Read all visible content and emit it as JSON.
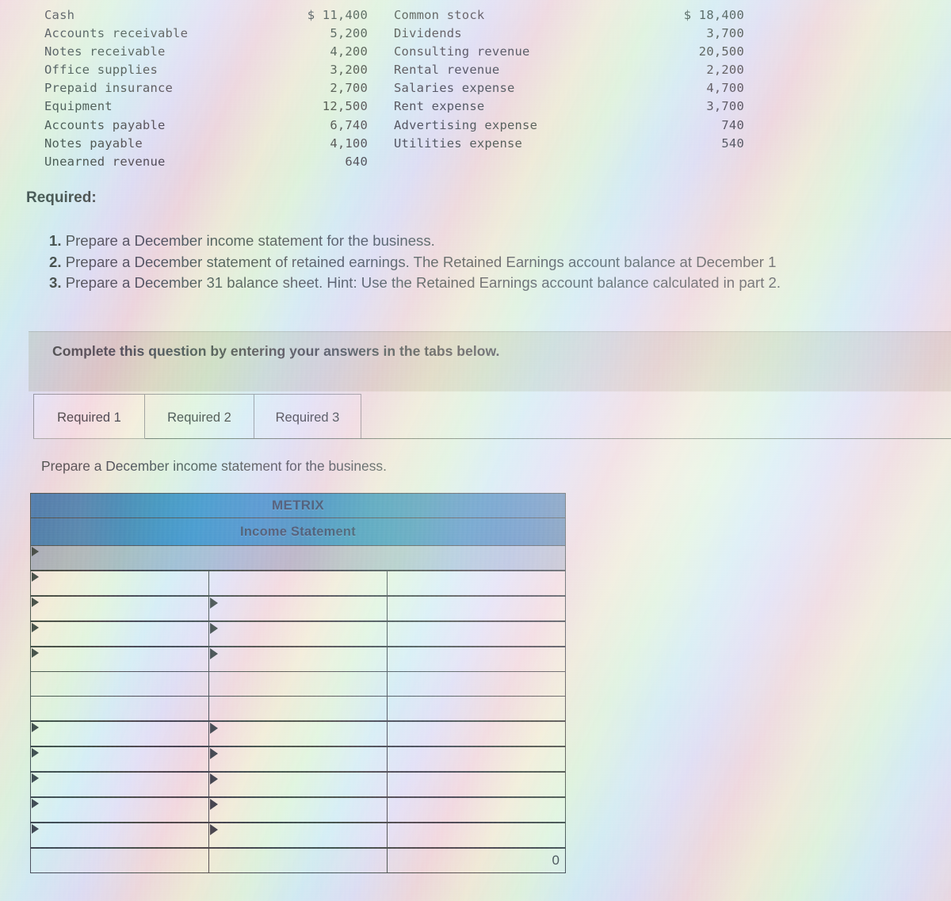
{
  "accounts": {
    "left": [
      {
        "name": "Cash",
        "amount": "$ 11,400"
      },
      {
        "name": "Accounts receivable",
        "amount": "5,200"
      },
      {
        "name": "Notes receivable",
        "amount": "4,200"
      },
      {
        "name": "Office supplies",
        "amount": "3,200"
      },
      {
        "name": "Prepaid insurance",
        "amount": "2,700"
      },
      {
        "name": "Equipment",
        "amount": "12,500"
      },
      {
        "name": "Accounts payable",
        "amount": "6,740"
      },
      {
        "name": "Notes payable",
        "amount": "4,100"
      },
      {
        "name": "Unearned revenue",
        "amount": "640"
      }
    ],
    "right": [
      {
        "name": "Common stock",
        "amount": "$ 18,400"
      },
      {
        "name": "Dividends",
        "amount": "3,700"
      },
      {
        "name": "Consulting revenue",
        "amount": "20,500"
      },
      {
        "name": "Rental revenue",
        "amount": "2,200"
      },
      {
        "name": "Salaries expense",
        "amount": "4,700"
      },
      {
        "name": "Rent expense",
        "amount": "3,700"
      },
      {
        "name": "Advertising expense",
        "amount": "740"
      },
      {
        "name": "Utilities expense",
        "amount": "540"
      }
    ]
  },
  "required": {
    "heading": "Required:",
    "items": [
      {
        "num": "1.",
        "text": "Prepare a December income statement for the business."
      },
      {
        "num": "2.",
        "text": "Prepare a December statement of retained earnings. The Retained Earnings account balance at December 1"
      },
      {
        "num": "3.",
        "text": "Prepare a December 31 balance sheet. Hint: Use the Retained Earnings account balance calculated in part 2."
      }
    ]
  },
  "banner": {
    "text": "Complete this question by entering your answers in the tabs below."
  },
  "tabs": [
    {
      "label": "Required 1",
      "active": true
    },
    {
      "label": "Required 2",
      "active": false
    },
    {
      "label": "Required 3",
      "active": false
    }
  ],
  "sub_prompt": "Prepare a December income statement for the business.",
  "statement": {
    "company": "METRIX",
    "title": "Income Statement",
    "columns": [
      "",
      "",
      ""
    ],
    "rows": [
      {
        "type": "spacer",
        "label": "",
        "v1": "",
        "v2": ""
      },
      {
        "type": "entry",
        "label": "",
        "v1": "",
        "v2": ""
      },
      {
        "type": "entry",
        "label": "",
        "v1": "",
        "v2": ""
      },
      {
        "type": "entry",
        "label": "",
        "v1": "",
        "v2": ""
      },
      {
        "type": "total",
        "label": "",
        "v1": "",
        "v2": ""
      },
      {
        "type": "plain",
        "label": "",
        "v1": "",
        "v2": ""
      },
      {
        "type": "entry",
        "label": "",
        "v1": "",
        "v2": ""
      },
      {
        "type": "entry",
        "label": "",
        "v1": "",
        "v2": ""
      },
      {
        "type": "entry",
        "label": "",
        "v1": "",
        "v2": ""
      },
      {
        "type": "entry",
        "label": "",
        "v1": "",
        "v2": ""
      },
      {
        "type": "entry",
        "label": "",
        "v1": "",
        "v2": ""
      },
      {
        "type": "footer",
        "label": "",
        "v1": "",
        "v2": "0"
      }
    ],
    "final_value": "0"
  },
  "colors": {
    "header_blue": "#1f8fc6",
    "header_blue_dark": "#2f6fb0",
    "banner_gray": "#ced0c6",
    "ink": "#2a2f33",
    "rule": "#2d3338"
  }
}
